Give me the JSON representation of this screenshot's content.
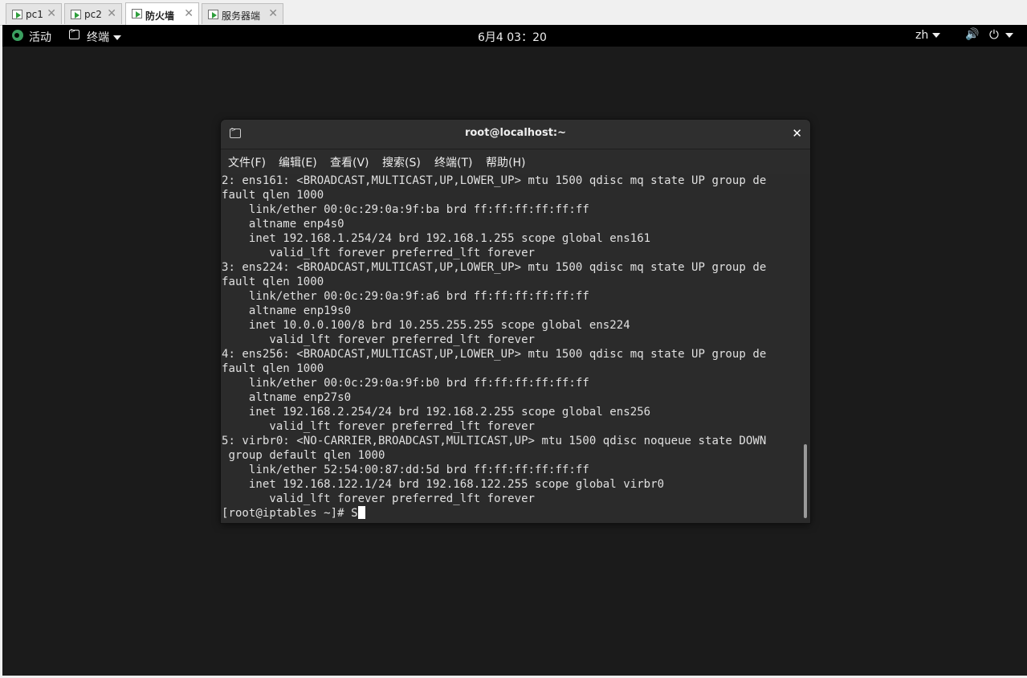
{
  "vm_tabs": [
    {
      "label": "pc1",
      "close": "✕"
    },
    {
      "label": "pc2",
      "close": "✕"
    },
    {
      "label": "防火墙",
      "close": "✕"
    },
    {
      "label": "服务器端",
      "close": "✕"
    }
  ],
  "active_tab_index": 2,
  "topbar": {
    "activities": "活动",
    "app_menu": "终端",
    "clock": "6月4 03：20",
    "language": "zh",
    "volume_icon": "🔊",
    "power_icon": "⏻"
  },
  "terminal": {
    "title": "root@localhost:~",
    "close_glyph": "✕",
    "menu": [
      "文件(F)",
      "编辑(E)",
      "查看(V)",
      "搜索(S)",
      "终端(T)",
      "帮助(H)"
    ],
    "lines": [
      "2: ens161: <BROADCAST,MULTICAST,UP,LOWER_UP> mtu 1500 qdisc mq state UP group de",
      "fault qlen 1000",
      "    link/ether 00:0c:29:0a:9f:ba brd ff:ff:ff:ff:ff:ff",
      "    altname enp4s0",
      "    inet 192.168.1.254/24 brd 192.168.1.255 scope global ens161",
      "       valid_lft forever preferred_lft forever",
      "3: ens224: <BROADCAST,MULTICAST,UP,LOWER_UP> mtu 1500 qdisc mq state UP group de",
      "fault qlen 1000",
      "    link/ether 00:0c:29:0a:9f:a6 brd ff:ff:ff:ff:ff:ff",
      "    altname enp19s0",
      "    inet 10.0.0.100/8 brd 10.255.255.255 scope global ens224",
      "       valid_lft forever preferred_lft forever",
      "4: ens256: <BROADCAST,MULTICAST,UP,LOWER_UP> mtu 1500 qdisc mq state UP group de",
      "fault qlen 1000",
      "    link/ether 00:0c:29:0a:9f:b0 brd ff:ff:ff:ff:ff:ff",
      "    altname enp27s0",
      "    inet 192.168.2.254/24 brd 192.168.2.255 scope global ens256",
      "       valid_lft forever preferred_lft forever",
      "5: virbr0: <NO-CARRIER,BROADCAST,MULTICAST,UP> mtu 1500 qdisc noqueue state DOWN",
      " group default qlen 1000",
      "    link/ether 52:54:00:87:dd:5d brd ff:ff:ff:ff:ff:ff",
      "    inet 192.168.122.1/24 brd 192.168.122.255 scope global virbr0",
      "       valid_lft forever preferred_lft forever"
    ],
    "prompt": "[root@iptables ~]# ",
    "input": "S"
  },
  "colors": {
    "terminal_bg": "#2b2b2b",
    "terminal_fg": "#e0e0e0",
    "topbar_bg": "#000000",
    "desktop_bg": "#1b1b1b"
  }
}
